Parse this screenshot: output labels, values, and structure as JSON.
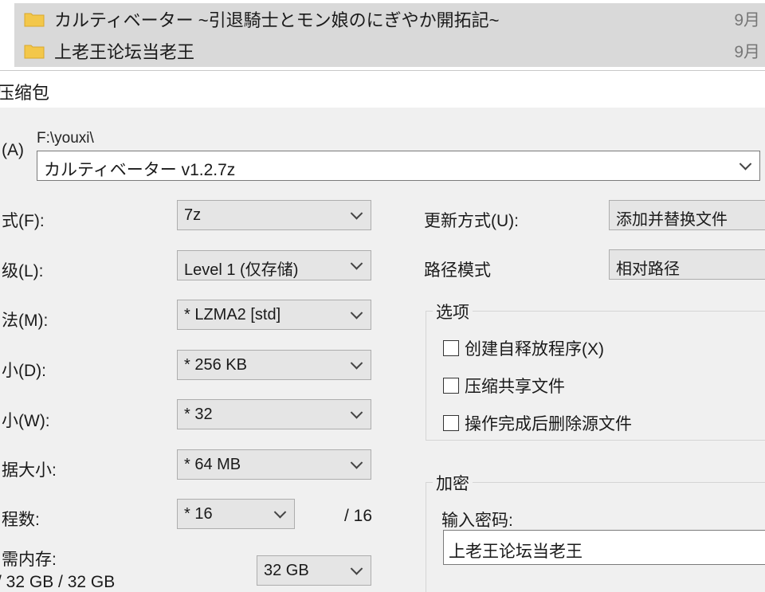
{
  "file_list": {
    "rows": [
      {
        "name": "カルティベーター ~引退騎士とモン娘のにぎやか開拓記~",
        "date": "9月"
      },
      {
        "name": "上老王论坛当老王",
        "date": "9月"
      }
    ]
  },
  "dialog": {
    "title": "压缩包",
    "archive_label": "(A)",
    "path": "F:\\youxi\\",
    "archive_name": "カルティベーター v1.2.7z",
    "left": {
      "format_label": "式(F):",
      "format_value": "7z",
      "level_label": "级(L):",
      "level_value": "Level 1 (仅存储)",
      "method_label": "法(M):",
      "method_value": "* LZMA2 [std]",
      "dict_label": "小(D):",
      "dict_value": "* 256 KB",
      "word_label": "小(W):",
      "word_value": "* 32",
      "solid_label": "据大小:",
      "solid_value": "* 64 MB",
      "threads_label": "程数:",
      "threads_value": "* 16",
      "threads_max": "/ 16",
      "memory_label": "需内存:",
      "memory_value": "/ 32 GB / 32 GB",
      "memory_combo": "32 GB"
    },
    "right": {
      "update_label": "更新方式(U):",
      "update_value": "添加并替换文件",
      "pathmode_label": "路径模式",
      "pathmode_value": "相对路径",
      "options_title": "选项",
      "opt_sfx": "创建自释放程序(X)",
      "opt_shared": "压缩共享文件",
      "opt_delete": "操作完成后删除源文件",
      "encrypt_title": "加密",
      "password_label": "输入密码:",
      "password_value": "上老王论坛当老王"
    }
  }
}
